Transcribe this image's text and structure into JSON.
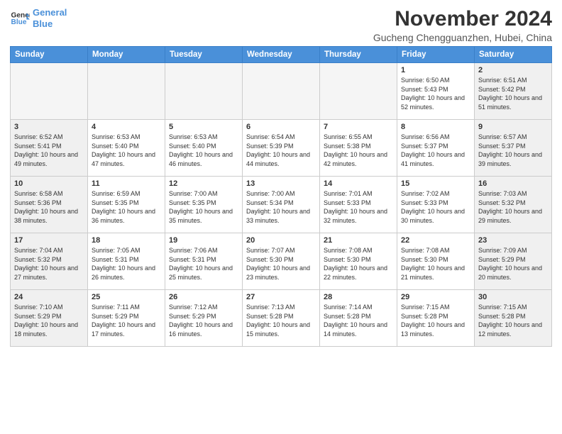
{
  "header": {
    "logo_line1": "General",
    "logo_line2": "Blue",
    "month_title": "November 2024",
    "location": "Gucheng Chengguanzhen, Hubei, China"
  },
  "weekdays": [
    "Sunday",
    "Monday",
    "Tuesday",
    "Wednesday",
    "Thursday",
    "Friday",
    "Saturday"
  ],
  "weeks": [
    [
      {
        "day": "",
        "info": "",
        "empty": true
      },
      {
        "day": "",
        "info": "",
        "empty": true
      },
      {
        "day": "",
        "info": "",
        "empty": true
      },
      {
        "day": "",
        "info": "",
        "empty": true
      },
      {
        "day": "",
        "info": "",
        "empty": true
      },
      {
        "day": "1",
        "info": "Sunrise: 6:50 AM\nSunset: 5:43 PM\nDaylight: 10 hours and 52 minutes."
      },
      {
        "day": "2",
        "info": "Sunrise: 6:51 AM\nSunset: 5:42 PM\nDaylight: 10 hours and 51 minutes."
      }
    ],
    [
      {
        "day": "3",
        "info": "Sunrise: 6:52 AM\nSunset: 5:41 PM\nDaylight: 10 hours and 49 minutes."
      },
      {
        "day": "4",
        "info": "Sunrise: 6:53 AM\nSunset: 5:40 PM\nDaylight: 10 hours and 47 minutes."
      },
      {
        "day": "5",
        "info": "Sunrise: 6:53 AM\nSunset: 5:40 PM\nDaylight: 10 hours and 46 minutes."
      },
      {
        "day": "6",
        "info": "Sunrise: 6:54 AM\nSunset: 5:39 PM\nDaylight: 10 hours and 44 minutes."
      },
      {
        "day": "7",
        "info": "Sunrise: 6:55 AM\nSunset: 5:38 PM\nDaylight: 10 hours and 42 minutes."
      },
      {
        "day": "8",
        "info": "Sunrise: 6:56 AM\nSunset: 5:37 PM\nDaylight: 10 hours and 41 minutes."
      },
      {
        "day": "9",
        "info": "Sunrise: 6:57 AM\nSunset: 5:37 PM\nDaylight: 10 hours and 39 minutes."
      }
    ],
    [
      {
        "day": "10",
        "info": "Sunrise: 6:58 AM\nSunset: 5:36 PM\nDaylight: 10 hours and 38 minutes."
      },
      {
        "day": "11",
        "info": "Sunrise: 6:59 AM\nSunset: 5:35 PM\nDaylight: 10 hours and 36 minutes."
      },
      {
        "day": "12",
        "info": "Sunrise: 7:00 AM\nSunset: 5:35 PM\nDaylight: 10 hours and 35 minutes."
      },
      {
        "day": "13",
        "info": "Sunrise: 7:00 AM\nSunset: 5:34 PM\nDaylight: 10 hours and 33 minutes."
      },
      {
        "day": "14",
        "info": "Sunrise: 7:01 AM\nSunset: 5:33 PM\nDaylight: 10 hours and 32 minutes."
      },
      {
        "day": "15",
        "info": "Sunrise: 7:02 AM\nSunset: 5:33 PM\nDaylight: 10 hours and 30 minutes."
      },
      {
        "day": "16",
        "info": "Sunrise: 7:03 AM\nSunset: 5:32 PM\nDaylight: 10 hours and 29 minutes."
      }
    ],
    [
      {
        "day": "17",
        "info": "Sunrise: 7:04 AM\nSunset: 5:32 PM\nDaylight: 10 hours and 27 minutes."
      },
      {
        "day": "18",
        "info": "Sunrise: 7:05 AM\nSunset: 5:31 PM\nDaylight: 10 hours and 26 minutes."
      },
      {
        "day": "19",
        "info": "Sunrise: 7:06 AM\nSunset: 5:31 PM\nDaylight: 10 hours and 25 minutes."
      },
      {
        "day": "20",
        "info": "Sunrise: 7:07 AM\nSunset: 5:30 PM\nDaylight: 10 hours and 23 minutes."
      },
      {
        "day": "21",
        "info": "Sunrise: 7:08 AM\nSunset: 5:30 PM\nDaylight: 10 hours and 22 minutes."
      },
      {
        "day": "22",
        "info": "Sunrise: 7:08 AM\nSunset: 5:30 PM\nDaylight: 10 hours and 21 minutes."
      },
      {
        "day": "23",
        "info": "Sunrise: 7:09 AM\nSunset: 5:29 PM\nDaylight: 10 hours and 20 minutes."
      }
    ],
    [
      {
        "day": "24",
        "info": "Sunrise: 7:10 AM\nSunset: 5:29 PM\nDaylight: 10 hours and 18 minutes."
      },
      {
        "day": "25",
        "info": "Sunrise: 7:11 AM\nSunset: 5:29 PM\nDaylight: 10 hours and 17 minutes."
      },
      {
        "day": "26",
        "info": "Sunrise: 7:12 AM\nSunset: 5:29 PM\nDaylight: 10 hours and 16 minutes."
      },
      {
        "day": "27",
        "info": "Sunrise: 7:13 AM\nSunset: 5:28 PM\nDaylight: 10 hours and 15 minutes."
      },
      {
        "day": "28",
        "info": "Sunrise: 7:14 AM\nSunset: 5:28 PM\nDaylight: 10 hours and 14 minutes."
      },
      {
        "day": "29",
        "info": "Sunrise: 7:15 AM\nSunset: 5:28 PM\nDaylight: 10 hours and 13 minutes."
      },
      {
        "day": "30",
        "info": "Sunrise: 7:15 AM\nSunset: 5:28 PM\nDaylight: 10 hours and 12 minutes."
      }
    ]
  ]
}
